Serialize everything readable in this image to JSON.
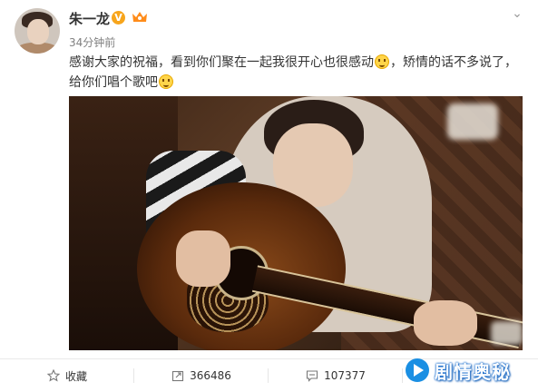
{
  "post": {
    "username": "朱一龙",
    "verified_mark": "V",
    "timestamp": "34分钟前",
    "text_part1": "感谢大家的祝福，看到你们聚在一起我很开心也很感动",
    "text_part2": "，矫情的话不多说了，给你们唱个歌吧",
    "emoji_1": "smile-emoji",
    "emoji_2": "laugh-emoji"
  },
  "actions": [
    {
      "label": "收藏",
      "icon": "star-icon"
    },
    {
      "label": "366486",
      "icon": "repost-icon"
    },
    {
      "label": "107377",
      "icon": "comment-icon"
    },
    {
      "label": "",
      "icon": "like-icon"
    }
  ],
  "watermark": {
    "text": "剧情奥秘"
  },
  "colors": {
    "verified": "#f7a51c",
    "accent": "#1a8fe3",
    "text": "#333333",
    "muted": "#808080"
  }
}
